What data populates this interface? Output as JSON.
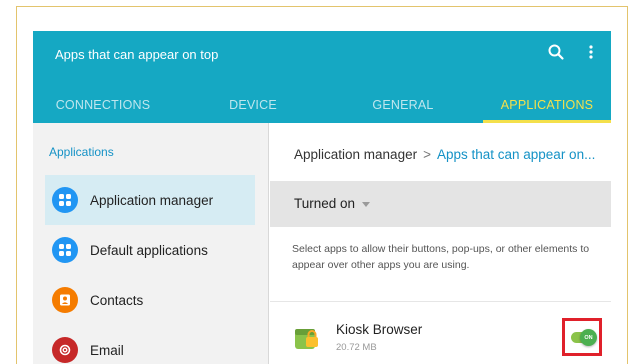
{
  "header": {
    "title": "Apps that can appear on top",
    "tabs": [
      {
        "label": "CONNECTIONS"
      },
      {
        "label": "DEVICE"
      },
      {
        "label": "GENERAL"
      },
      {
        "label": "APPLICATIONS"
      }
    ],
    "selected_tab": "APPLICATIONS",
    "icons": [
      "search-icon",
      "more-options-icon"
    ]
  },
  "sidebar": {
    "heading": "Applications",
    "items": [
      {
        "label": "Application manager",
        "icon": "grid-icon",
        "color": "#2196f3",
        "selected": true
      },
      {
        "label": "Default applications",
        "icon": "grid-icon",
        "color": "#2196f3",
        "selected": false
      },
      {
        "label": "Contacts",
        "icon": "contacts-icon",
        "color": "#f57c00",
        "selected": false
      },
      {
        "label": "Email",
        "icon": "email-icon",
        "color": "#c62828",
        "selected": false
      }
    ]
  },
  "main": {
    "breadcrumb": {
      "parent": "Application manager",
      "separator": ">",
      "current": "Apps that can appear on..."
    },
    "filter": {
      "label": "Turned on"
    },
    "description": "Select apps to allow their buttons, pop-ups, or other elements to appear over other apps you are using.",
    "apps": [
      {
        "name": "Kiosk Browser",
        "size": "20.72 MB",
        "icon": "kiosk-browser-icon",
        "toggle": {
          "state": "ON",
          "on": true
        }
      }
    ]
  },
  "colors": {
    "accent": "#15a8c3",
    "selected_tab": "#f4e04b",
    "link": "#1592c6",
    "highlight_box": "#e0202a",
    "toggle_on": "#4caf50"
  }
}
